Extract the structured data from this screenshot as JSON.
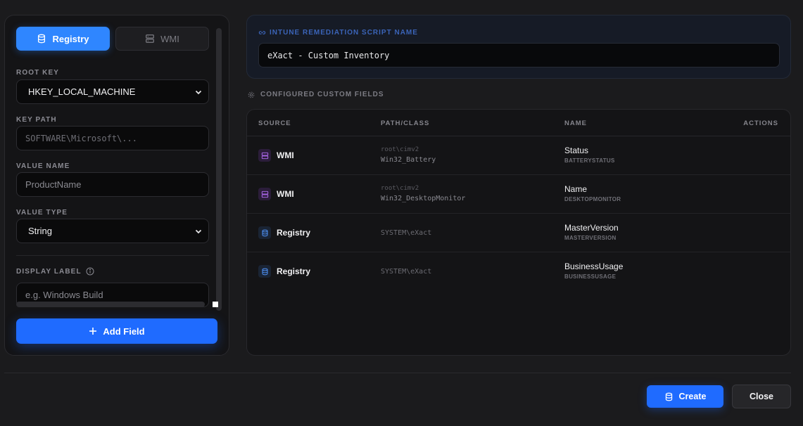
{
  "left": {
    "tabs": {
      "registry": "Registry",
      "wmi": "WMI"
    },
    "root_key": {
      "label": "ROOT KEY",
      "value": "HKEY_LOCAL_MACHINE"
    },
    "key_path": {
      "label": "KEY PATH",
      "placeholder": "SOFTWARE\\Microsoft\\..."
    },
    "value_name": {
      "label": "VALUE NAME",
      "placeholder": "ProductName"
    },
    "value_type": {
      "label": "VALUE TYPE",
      "value": "String"
    },
    "display_label": {
      "label": "DISPLAY LABEL",
      "placeholder": "e.g. Windows Build"
    },
    "add_button": "Add Field"
  },
  "script": {
    "label": "INTUNE REMEDIATION SCRIPT NAME",
    "value": "eXact - Custom Inventory"
  },
  "fields": {
    "title": "CONFIGURED CUSTOM FIELDS",
    "columns": {
      "source": "SOURCE",
      "path": "PATH/CLASS",
      "name": "NAME",
      "actions": "ACTIONS"
    },
    "rows": [
      {
        "source": "WMI",
        "namespace": "root\\cimv2",
        "class": "Win32_Battery",
        "name": "Status",
        "key": "BATTERYSTATUS"
      },
      {
        "source": "WMI",
        "namespace": "root\\cimv2",
        "class": "Win32_DesktopMonitor",
        "name": "Name",
        "key": "DESKTOPMONITOR"
      },
      {
        "source": "Registry",
        "path": "SYSTEM\\eXact",
        "name": "MasterVersion",
        "key": "MASTERVERSION"
      },
      {
        "source": "Registry",
        "path": "SYSTEM\\eXact",
        "name": "BusinessUsage",
        "key": "BUSINESSUSAGE"
      }
    ]
  },
  "footer": {
    "create": "Create",
    "close": "Close"
  },
  "colors": {
    "accent": "#1f6bff",
    "wmi": "#a463e0",
    "registry": "#4a88e6"
  }
}
